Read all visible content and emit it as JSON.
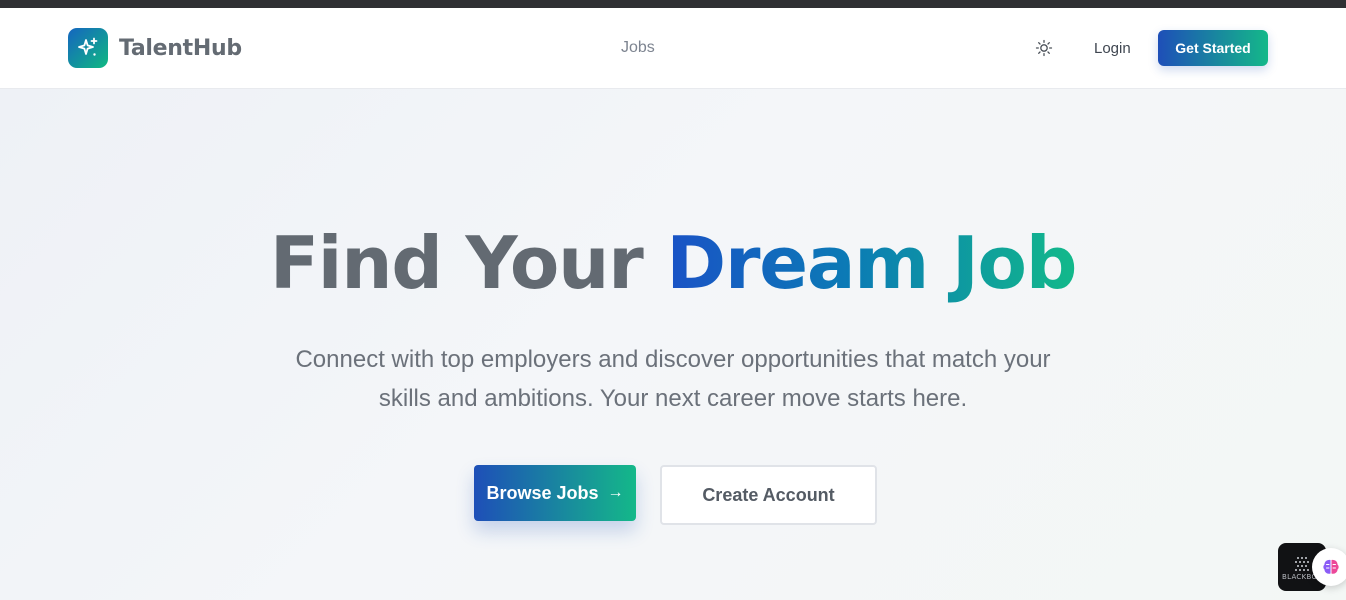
{
  "brand": {
    "name": "TalentHub",
    "logo_icon": "sparkles-icon"
  },
  "nav": {
    "jobs_label": "Jobs",
    "login_label": "Login",
    "get_started_label": "Get Started",
    "theme_icon": "sun-icon"
  },
  "hero": {
    "title_part1": "Find Your",
    "title_part2": "Dream Job",
    "subtitle": "Connect with top employers and discover opportunities that match your skills and ambitions. Your next career move starts here.",
    "browse_label": "Browse Jobs",
    "browse_arrow": "→",
    "create_label": "Create Account"
  },
  "widgets": {
    "dark_label": "BLACKBOX",
    "ai_icon": "brain-icon"
  },
  "colors": {
    "accent_start": "#1e4fb8",
    "accent_end": "#14b889",
    "text_gray": "#636a72"
  }
}
